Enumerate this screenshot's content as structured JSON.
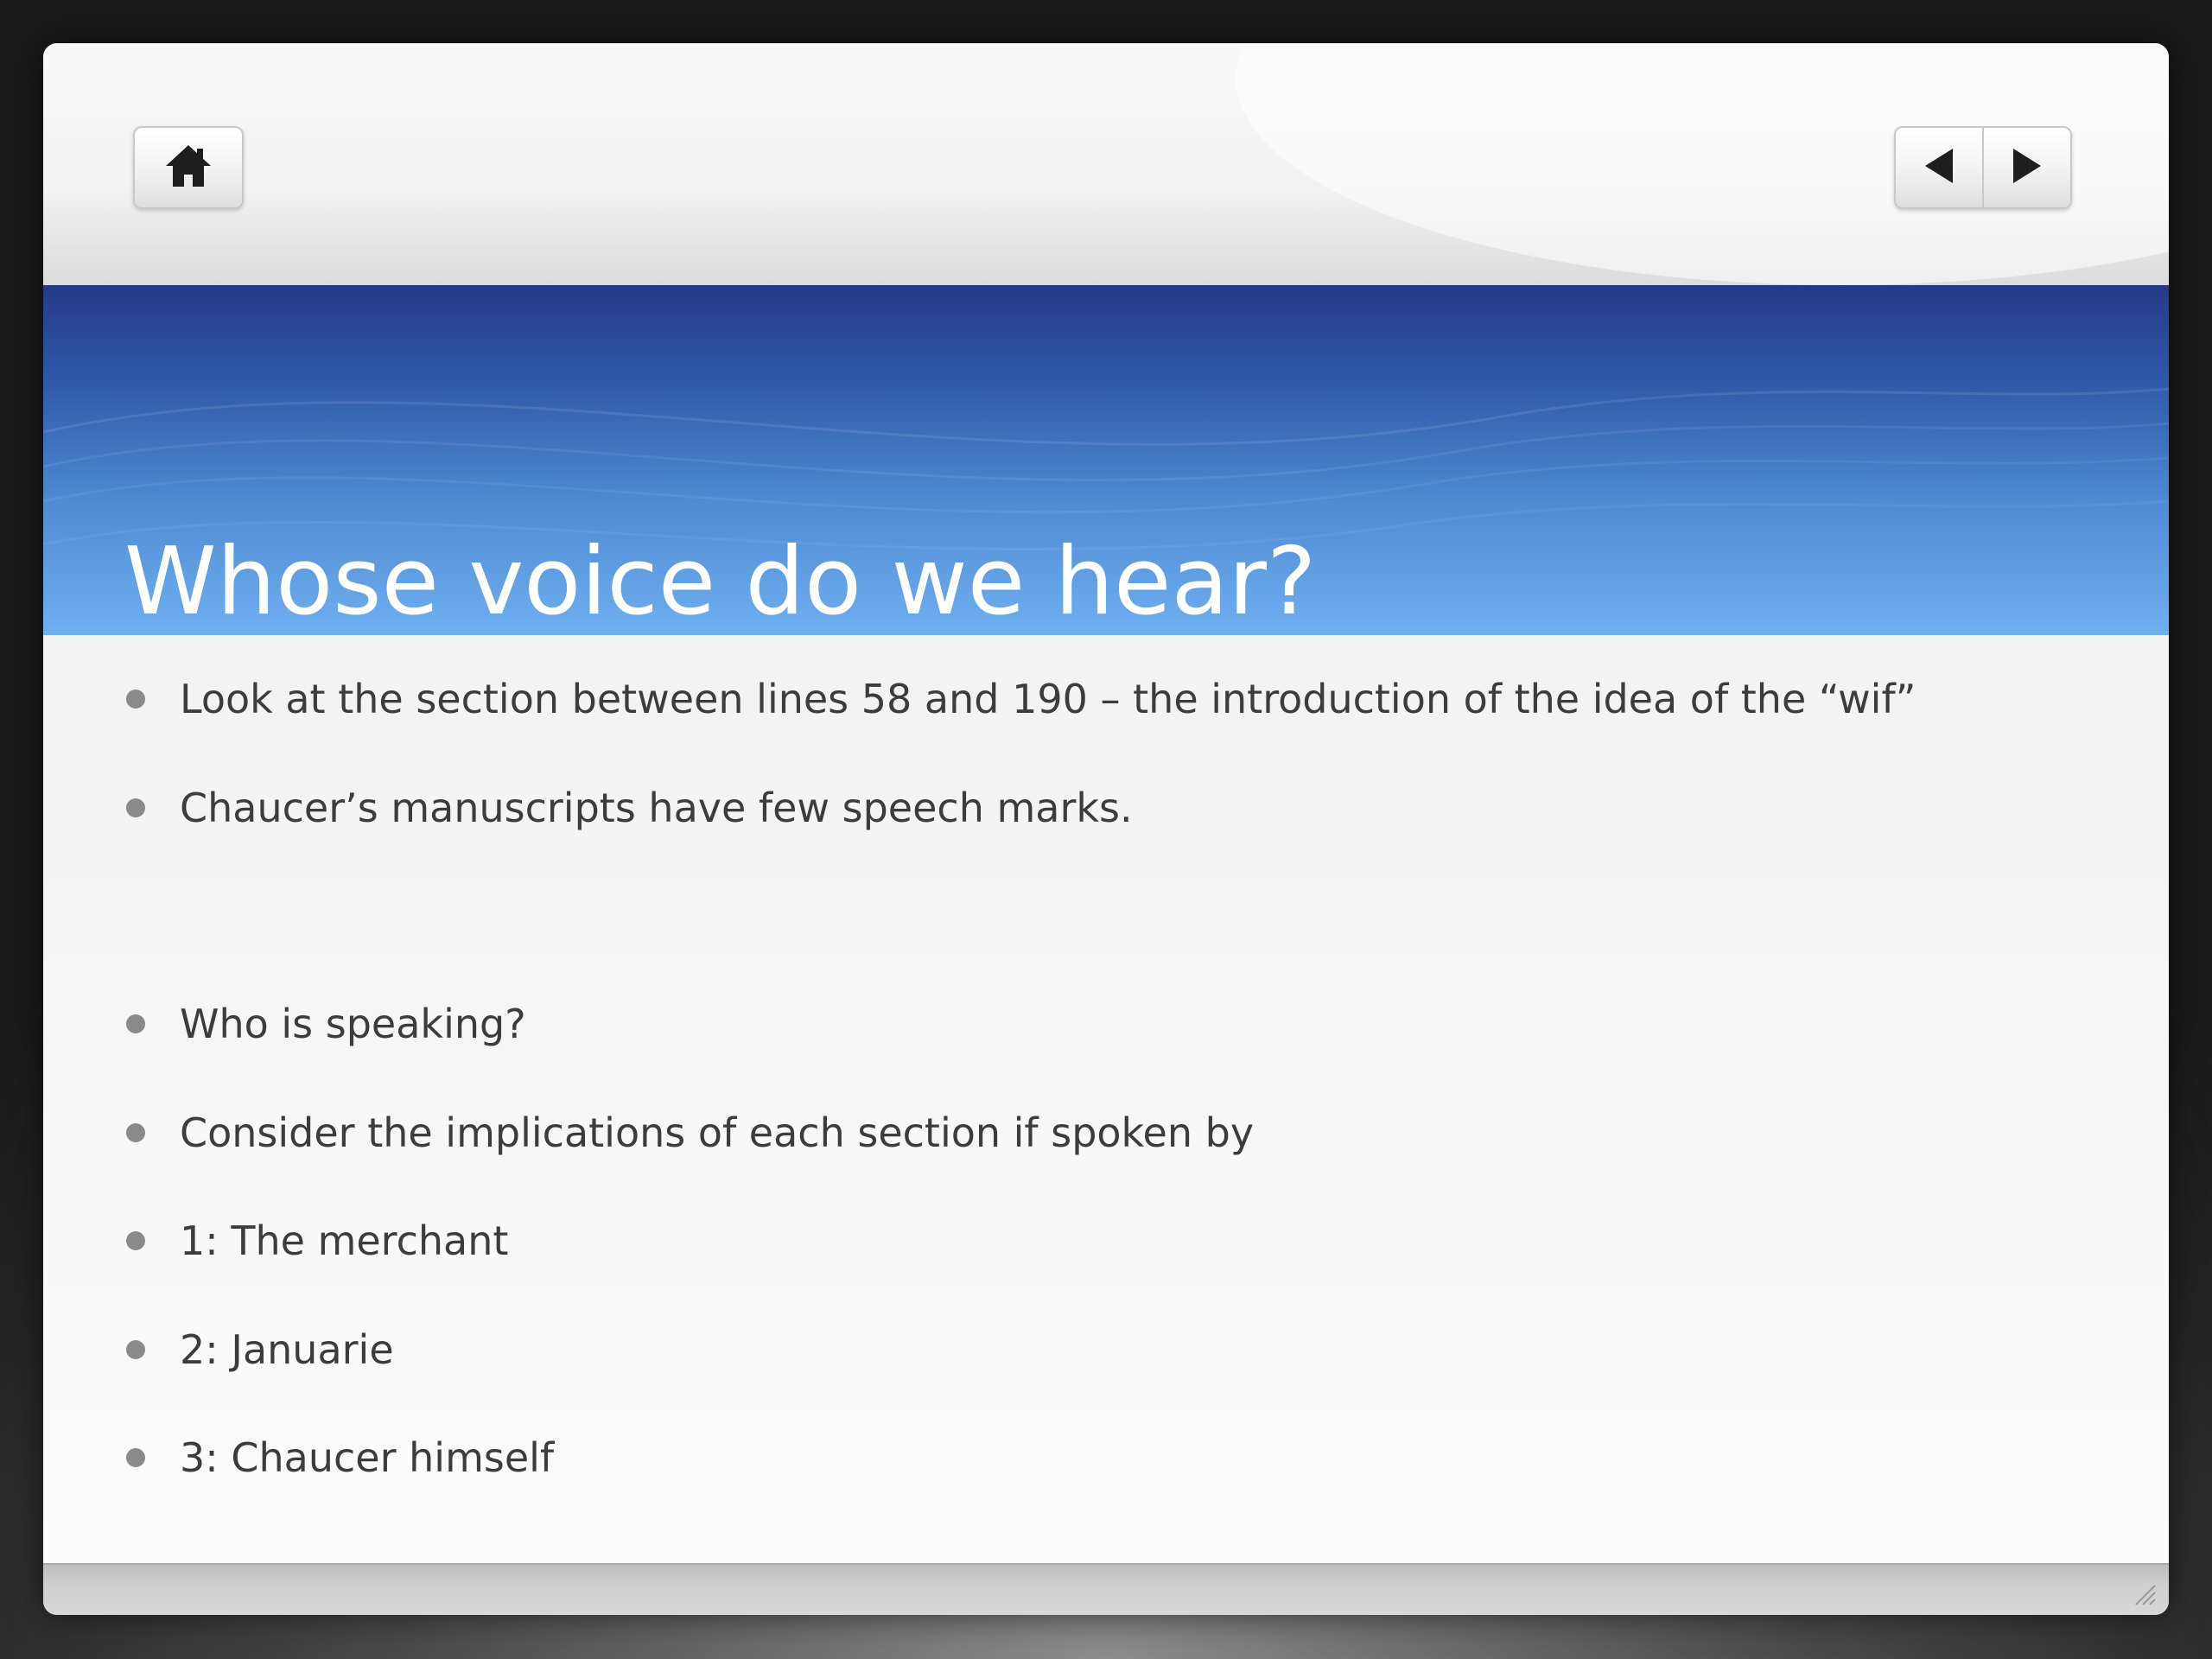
{
  "slide": {
    "title": "Whose voice do we hear?",
    "bullets": [
      "Look at the section between lines 58 and 190 – the introduction of the idea of the “wif”",
      "Chaucer’s manuscripts have few speech marks.",
      "Who is speaking?",
      "Consider the implications of each section if spoken by",
      "1: The merchant",
      "2: Januarie",
      "3: Chaucer himself"
    ]
  },
  "controls": {
    "home_icon": "home-icon",
    "prev_icon": "triangle-left-icon",
    "next_icon": "triangle-right-icon"
  },
  "colors": {
    "title_band_top": "#243a86",
    "title_band_bottom": "#6fb0f0",
    "title_text": "#ffffff",
    "body_text": "#3c3c3c",
    "bullet": "#8a8a8a"
  }
}
